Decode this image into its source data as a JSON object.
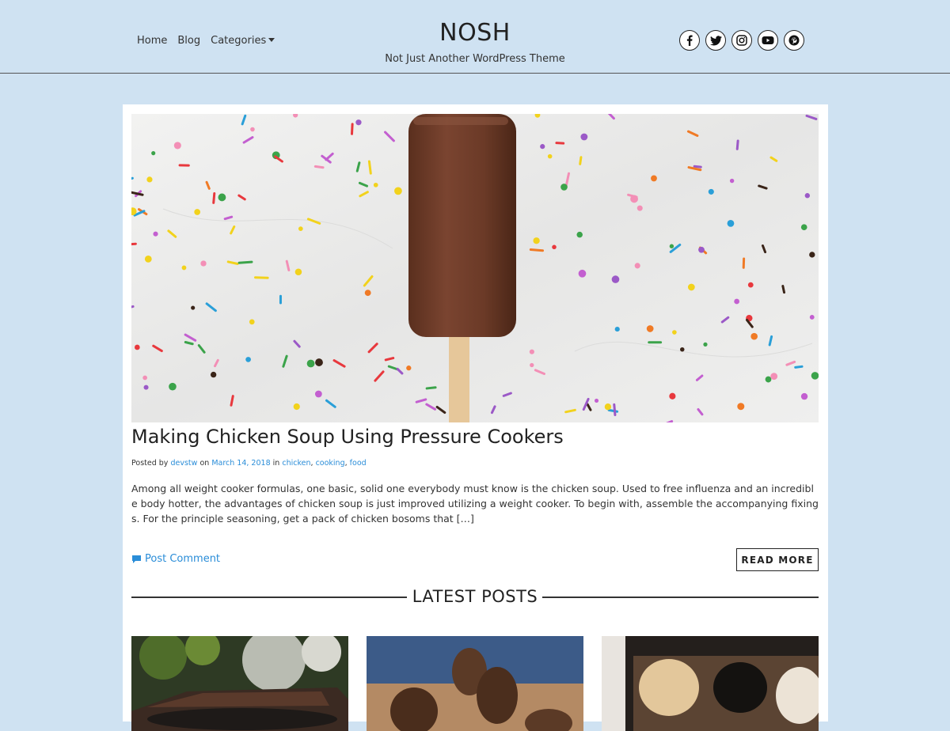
{
  "nav": {
    "home": "Home",
    "blog": "Blog",
    "categories": "Categories"
  },
  "site": {
    "title": "NOSH",
    "tagline": "Not Just Another WordPress Theme"
  },
  "social": [
    "facebook-icon",
    "twitter-icon",
    "instagram-icon",
    "youtube-icon",
    "pinterest-icon"
  ],
  "post": {
    "title": "Making Chicken Soup Using Pressure Cookers",
    "meta_posted_by": "Posted by",
    "author": "devstw",
    "meta_on": "on",
    "date": "March 14, 2018",
    "meta_in": "in",
    "cat1": "chicken",
    "cat2": "cooking",
    "cat3": "food",
    "excerpt": "Among all weight cooker formulas, one basic, solid one everybody must know is the chicken soup. Used to free influenza and an incredible body hotter, the advantages of chicken soup is just improved utilizing a weight cooker. To begin with, assemble the accompanying fixings. For the principle seasoning, get a pack of chicken bosoms that […]",
    "comment_label": "Post Comment",
    "read_more": "READ MORE"
  },
  "latest": {
    "heading": "LATEST POSTS"
  },
  "colors": {
    "background": "#cfe2f2",
    "link": "#2a8dd8",
    "text": "#333333"
  }
}
